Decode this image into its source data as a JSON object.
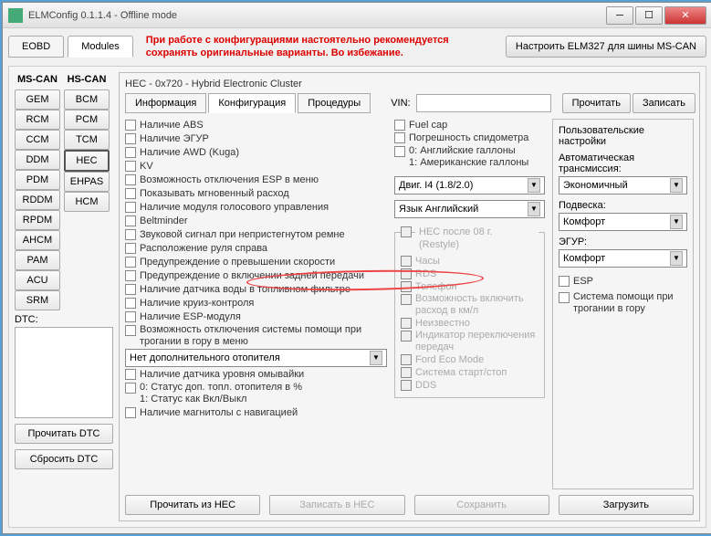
{
  "window": {
    "title": "ELMConfig 0.1.1.4 - Offline mode"
  },
  "tabs": {
    "eobd": "EOBD",
    "modules": "Modules"
  },
  "warning": "При работе с конфигурациями настоятельно рекомендуется сохранять оригинальные варианты. Во избежание.",
  "elm_btn": "Настроить ELM327 для шины MS-CAN",
  "bus": {
    "mscan": "MS-CAN",
    "hscan": "HS-CAN"
  },
  "mscan_mods": [
    "GEM",
    "RCM",
    "CCM",
    "DDM",
    "PDM",
    "RDDM",
    "RPDM",
    "AHCM",
    "PAM",
    "ACU",
    "SRM"
  ],
  "hscan_mods": [
    "BCM",
    "PCM",
    "TCM",
    "HEC",
    "EHPAS",
    "HCM"
  ],
  "dtc": {
    "label": "DTC:",
    "read": "Прочитать DTC",
    "reset": "Сбросить DTC"
  },
  "panel": {
    "header": "HEC - 0x720 - Hybrid Electronic Cluster",
    "tabs": {
      "info": "Информация",
      "config": "Конфигурация",
      "proc": "Процедуры"
    },
    "vin_label": "VIN:",
    "vin_value": "",
    "read": "Прочитать",
    "write": "Записать"
  },
  "checkboxes_left": [
    "Наличие ABS",
    "Наличие ЭГУР",
    "Наличие AWD (Kuga)",
    "KV",
    "Возможность отключения ESP в меню",
    "Показывать мгновенный расход",
    "Наличие модуля голосового управления",
    "Beltminder",
    "Звуковой сигнал при непристегнутом ремне",
    "Расположение руля справа",
    "Предупреждение о превышении скорости",
    "Предупреждение о включении задней передачи",
    "Наличие датчика воды в топливном фильтре",
    "Наличие круиз-контроля",
    "Наличие ESP-модуля"
  ],
  "left_multi1": "Возможность отключения системы помощи при трогании в гору в меню",
  "heater_select": "Нет дополнительного отопителя",
  "left_after": [
    "Наличие датчика уровня омывайки"
  ],
  "left_multi2": "0: Статус доп. топл. отопителя в %\n1: Статус как Вкл/Выкл",
  "left_last": "Наличие магнитолы с навигацией",
  "checkboxes_mid_top": [
    "Fuel cap",
    "Погрешность спидометра"
  ],
  "mid_multi": "0: Английские галлоны\n1: Американские галлоны",
  "mid_selects": {
    "engine": "Двиг. I4 (1.8/2.0)",
    "lang": "Язык Английский"
  },
  "restyle_title": "HEC после 08 г. (Restyle)",
  "restyle_items": [
    "Часы",
    "RDS",
    "Телефон",
    "Возможность включить расход в км/л",
    "Неизвестно",
    "Индикатор переключения передач",
    "Ford Eco Mode",
    "Система старт/стоп",
    "DDS"
  ],
  "user_settings": {
    "title": "Пользовательские настройки",
    "trans_label": "Автоматическая трансмиссия:",
    "trans": "Экономичный",
    "susp_label": "Подвеска:",
    "susp": "Комфорт",
    "egur_label": "ЭГУР:",
    "egur": "Комфорт",
    "esp": "ESP",
    "hill": "Система помощи при трогании в гору"
  },
  "footer": {
    "read_hec": "Прочитать из HEC",
    "write_hec": "Записать в HEC",
    "save": "Сохранить",
    "load": "Загрузить"
  }
}
